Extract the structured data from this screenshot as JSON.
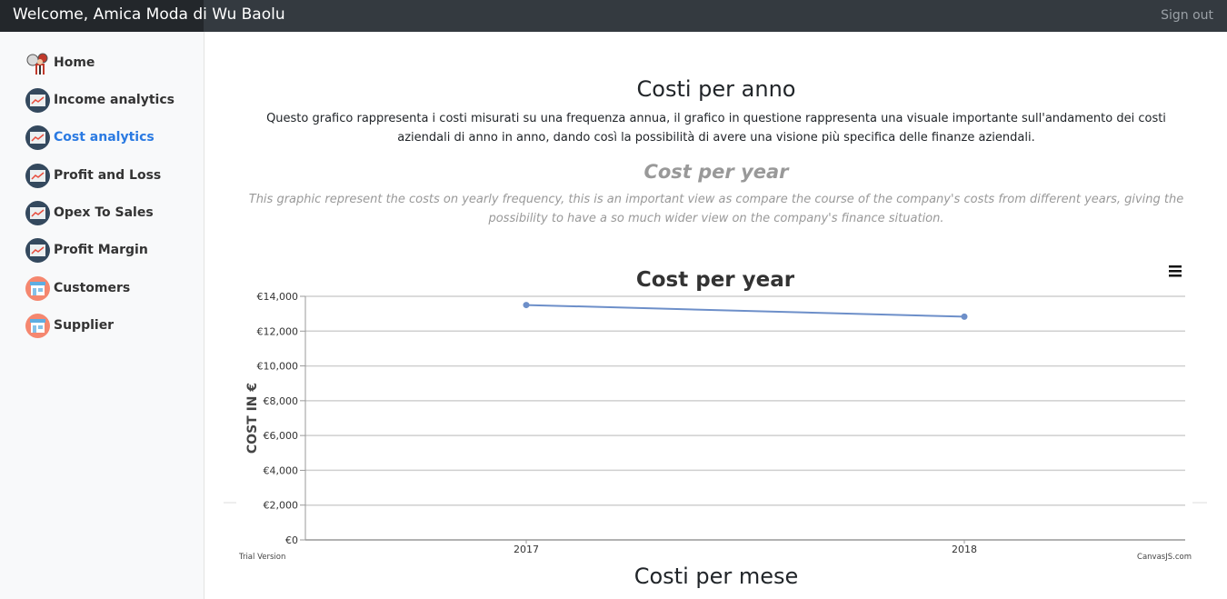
{
  "header": {
    "brand": "Welcome, Amica Moda di Wu Baolu",
    "sign_out": "Sign out"
  },
  "sidebar": {
    "items": [
      {
        "label": "Home",
        "icon": "home-icon",
        "active": false
      },
      {
        "label": "Income analytics",
        "icon": "chart-icon",
        "active": false
      },
      {
        "label": "Cost analytics",
        "icon": "chart-icon",
        "active": true
      },
      {
        "label": "Profit and Loss",
        "icon": "chart-icon",
        "active": false
      },
      {
        "label": "Opex To Sales",
        "icon": "chart-icon",
        "active": false
      },
      {
        "label": "Profit Margin",
        "icon": "chart-icon",
        "active": false
      },
      {
        "label": "Customers",
        "icon": "store-icon",
        "active": false
      },
      {
        "label": "Supplier",
        "icon": "store-icon",
        "active": false
      }
    ]
  },
  "section": {
    "title_it": "Costi per anno",
    "desc_it": "Questo grafico rappresenta i costi misurati su una frequenza annua, il grafico in questione rappresenta una visuale importante sull'andamento dei costi aziendali di anno in anno, dando così la possibilità di avere una visione più specifica delle finanze aziendali.",
    "title_en": "Cost per year",
    "desc_en": "This graphic represent the costs on yearly frequency, this is an important view as compare the course of the company's costs from different years, giving the possibility to have a so much wider view on the company's finance situation.",
    "next_title": "Costi per mese"
  },
  "chart_footer": {
    "trial": "Trial Version",
    "credit": "CanvasJS.com"
  },
  "colors": {
    "accent": "#2a7ae2",
    "series": "#6d8fc9",
    "topbar": "#343a40"
  },
  "chart_data": {
    "type": "line",
    "title": "Cost per year",
    "ylabel": "COST IN €",
    "xlabel": "",
    "categories": [
      "2017",
      "2018"
    ],
    "values": [
      13500,
      12830
    ],
    "ylim": [
      0,
      14000
    ],
    "yticks": [
      0,
      2000,
      4000,
      6000,
      8000,
      10000,
      12000,
      14000
    ],
    "ytick_labels": [
      "€0",
      "€2,000",
      "€4,000",
      "€6,000",
      "€8,000",
      "€10,000",
      "€12,000",
      "€14,000"
    ],
    "grid": true
  }
}
